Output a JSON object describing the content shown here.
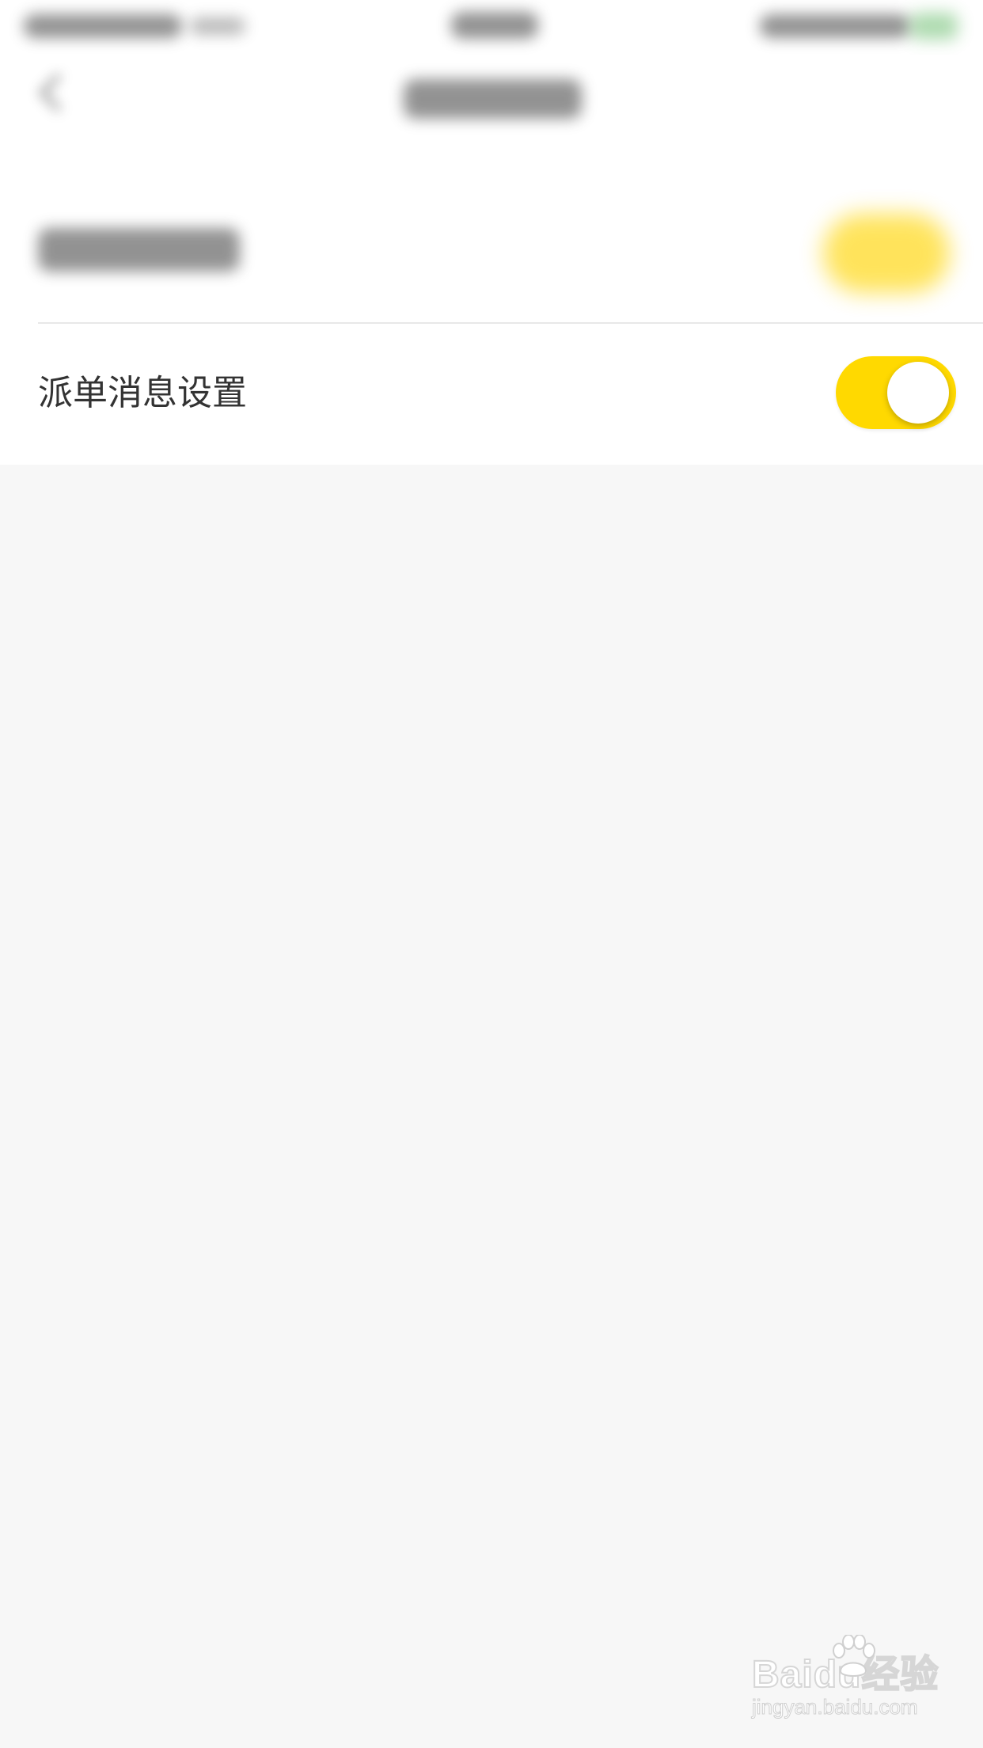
{
  "settings": {
    "dispatch_message_label": "派单消息设置",
    "dispatch_message_enabled": true
  },
  "colors": {
    "accent": "#ffd900",
    "background": "#f7f7f7",
    "card": "#ffffff",
    "label_text": "#333333"
  },
  "watermark": {
    "main": "Baidu经验",
    "sub": "jingyan.baidu.com"
  }
}
